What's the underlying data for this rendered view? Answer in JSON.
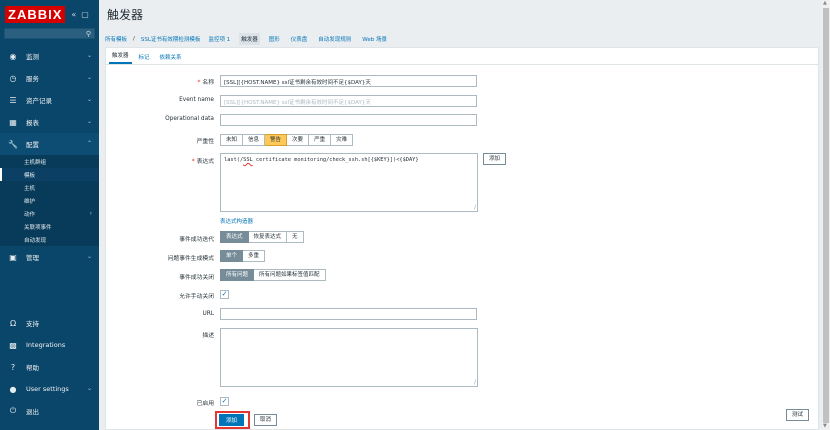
{
  "sidebar": {
    "logo": "ZABBIX",
    "collapse_icon": "«",
    "kiosk_icon": "▢",
    "search_placeholder": "",
    "menu": [
      {
        "label": "监测",
        "icon": "eye-icon"
      },
      {
        "label": "服务",
        "icon": "clock-icon"
      },
      {
        "label": "资产记录",
        "icon": "list-icon"
      },
      {
        "label": "报表",
        "icon": "chart-icon"
      },
      {
        "label": "配置",
        "icon": "wrench-icon"
      }
    ],
    "config_sub": [
      "主机群组",
      "模板",
      "主机",
      "维护",
      "动作",
      "关联项事件",
      "自动发现"
    ],
    "admin": {
      "label": "管理",
      "icon": "admin-icon"
    },
    "bottom": [
      {
        "label": "支持",
        "icon": "headset-icon"
      },
      {
        "label": "Integrations",
        "icon": "integrations-icon"
      },
      {
        "label": "帮助",
        "icon": "help-icon"
      },
      {
        "label": "User settings",
        "icon": "user-icon"
      },
      {
        "label": "退出",
        "icon": "power-icon"
      }
    ]
  },
  "header": {
    "title": "触发器"
  },
  "nav": {
    "crumb_all": "所有模板",
    "crumb_sep": "/",
    "crumb_template": "SSL证书有效期检测模板",
    "tabs": [
      "监控项 1",
      "触发器",
      "图形",
      "仪表盘",
      "自动发现规则",
      "Web 场景"
    ]
  },
  "subtabs": [
    "触发器",
    "标记",
    "依赖关系"
  ],
  "form": {
    "name_label": "名称",
    "name_value": "[SSL][{HOST.NAME} ssl证书剩余有效时间不足{$DAY}天",
    "event_name_label": "Event name",
    "event_name_placeholder": "[SSL][{HOST.NAME} ssl证书剩余有效时间不足{$DAY}天",
    "opdata_label": "Operational data",
    "opdata_value": "",
    "severity_label": "严重性",
    "severity_options": [
      "未知",
      "信息",
      "警告",
      "次要",
      "严重",
      "灾难"
    ],
    "severity_selected": "警告",
    "expr_label": "表达式",
    "expr_pre": "last(/",
    "expr_err": "SSL",
    "expr_post": " certificate monitoring/check_ssh.sh[{$KEY}])<{$DAY}",
    "expr_add": "添加",
    "expr_builder": "表达式构造器",
    "ok_event_label": "事件成功迭代",
    "ok_event_options": [
      "表达式",
      "恢复表达式",
      "无"
    ],
    "problem_mode_label": "问题事件生成模式",
    "problem_mode_options": [
      "单个",
      "多重"
    ],
    "ok_close_label": "事件成功关闭",
    "ok_close_options": [
      "所有问题",
      "所有问题如果标签值匹配"
    ],
    "manual_close_label": "允许手动关闭",
    "manual_close_checked": "✓",
    "url_label": "URL",
    "url_value": "",
    "desc_label": "描述",
    "enabled_label": "已启用",
    "enabled_checked": "✓",
    "add_button": "添加",
    "cancel_button": "取消",
    "test_button": "测试"
  }
}
